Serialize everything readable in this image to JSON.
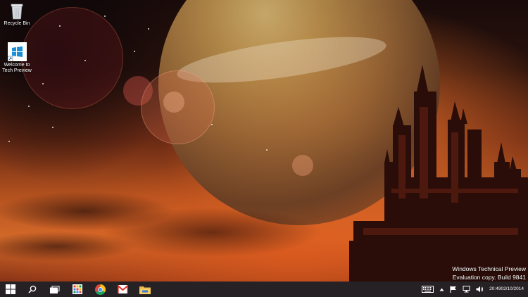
{
  "desktop": {
    "icons": [
      {
        "label": "Recycle Bin",
        "icon": "recycle-bin-icon"
      },
      {
        "label": "Welcome to Tech Preview",
        "icon": "windows-logo-icon"
      }
    ],
    "watermark": {
      "line1": "Windows Technical Preview",
      "line2": "Evaluation copy. Build 9841"
    }
  },
  "taskbar": {
    "pinned": [
      {
        "name": "start-button",
        "icon": "windows-logo-icon"
      },
      {
        "name": "search-button",
        "icon": "search-icon"
      },
      {
        "name": "task-view-button",
        "icon": "task-view-icon"
      },
      {
        "name": "store-app",
        "icon": "apps-grid-icon"
      },
      {
        "name": "chrome-app",
        "icon": "chrome-icon"
      },
      {
        "name": "gmail-app",
        "icon": "gmail-icon"
      },
      {
        "name": "file-explorer-app",
        "icon": "folder-icon"
      }
    ],
    "tray": {
      "icons": [
        "keyboard-icon",
        "chevron-up-icon",
        "action-center-flag-icon",
        "network-icon",
        "volume-icon"
      ],
      "time": "20:49",
      "date": "02/10/2014"
    }
  },
  "colors": {
    "taskbar": "#262428",
    "start_blue": "#ffffff",
    "accent_windows": "#1a8fd8"
  }
}
